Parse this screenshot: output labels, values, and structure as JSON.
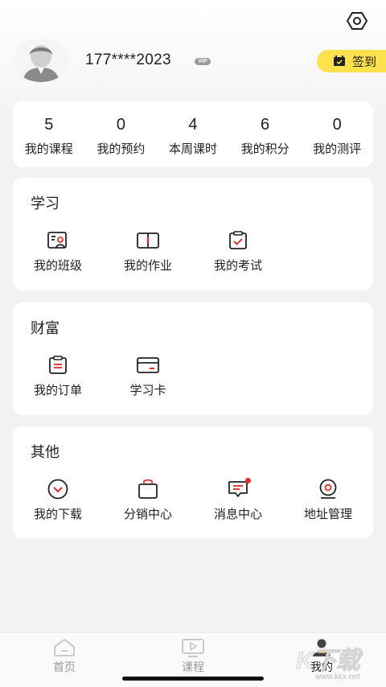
{
  "colors": {
    "accent_red": "#e52b2b",
    "signin_yellow": "#fde24d",
    "card_bg": "#ffffff",
    "page_bg": "#f2f2f2"
  },
  "profile": {
    "username": "177****2023",
    "vip_badge": "VIP",
    "signin_label": "签到"
  },
  "stats": [
    {
      "value": "5",
      "label": "我的课程"
    },
    {
      "value": "0",
      "label": "我的预约"
    },
    {
      "value": "4",
      "label": "本周课时"
    },
    {
      "value": "6",
      "label": "我的积分"
    },
    {
      "value": "0",
      "label": "我的测评"
    }
  ],
  "sections": {
    "study": {
      "title": "学习",
      "items": [
        {
          "label": "我的班级",
          "icon": "class-icon"
        },
        {
          "label": "我的作业",
          "icon": "homework-book-icon"
        },
        {
          "label": "我的考试",
          "icon": "exam-clipboard-icon"
        }
      ]
    },
    "wealth": {
      "title": "财富",
      "items": [
        {
          "label": "我的订单",
          "icon": "order-icon"
        },
        {
          "label": "学习卡",
          "icon": "card-icon"
        }
      ]
    },
    "other": {
      "title": "其他",
      "items": [
        {
          "label": "我的下载",
          "icon": "download-icon"
        },
        {
          "label": "分销中心",
          "icon": "shopping-bag-icon"
        },
        {
          "label": "消息中心",
          "icon": "message-icon"
        },
        {
          "label": "地址管理",
          "icon": "location-icon"
        }
      ]
    }
  },
  "tabbar": [
    {
      "label": "首页",
      "icon": "home-icon"
    },
    {
      "label": "课程",
      "icon": "course-play-icon"
    },
    {
      "label": "我的",
      "icon": "profile-icon"
    }
  ],
  "watermark": {
    "text": "K下载",
    "url": "www.kkx.net"
  }
}
